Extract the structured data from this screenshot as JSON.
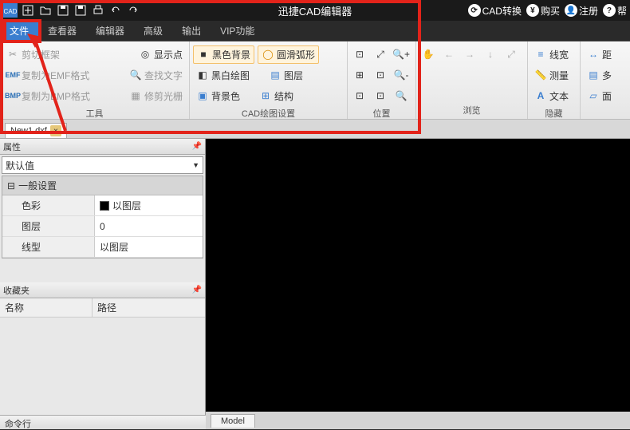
{
  "titlebar": {
    "title": "迅捷CAD编辑器",
    "right": {
      "cad_convert": "CAD转换",
      "buy": "购买",
      "register": "注册",
      "help": "帮"
    }
  },
  "menu": {
    "file": "文件",
    "viewer": "查看器",
    "editor": "编辑器",
    "advanced": "高级",
    "output": "输出",
    "vip": "VIP功能"
  },
  "ribbon": {
    "tools": {
      "clip_frame": "剪切框架",
      "copy_emf": "复制为EMF格式",
      "copy_bmp": "复制为BMP格式",
      "show_point": "显示点",
      "find_text": "查找文字",
      "trim_raster": "修剪光栅",
      "label": "工具"
    },
    "cad_draw": {
      "black_bg": "黑色背景",
      "smooth_arc": "圆滑弧形",
      "bw_draw": "黑白绘图",
      "layer": "图层",
      "bg_color": "背景色",
      "structure": "结构",
      "label": "CAD绘图设置"
    },
    "position": {
      "label": "位置"
    },
    "browse": {
      "label": "浏览"
    },
    "view": {
      "linewidth": "线宽",
      "measure": "测量",
      "text": "文本",
      "label": "隐藏"
    },
    "more": {
      "distance": "距",
      "multi": "多",
      "area": "面"
    }
  },
  "file_tabs": {
    "new1": "New1.dxf"
  },
  "panels": {
    "properties": "属性",
    "default_value": "默认值",
    "general_settings": "一般设置",
    "color": "色彩",
    "color_val": "以图层",
    "layer": "图层",
    "layer_val": "0",
    "linetype": "线型",
    "linetype_val": "以图层",
    "favorites": "收藏夹",
    "name_col": "名称",
    "path_col": "路径"
  },
  "model_tab": "Model",
  "status": "命令行"
}
